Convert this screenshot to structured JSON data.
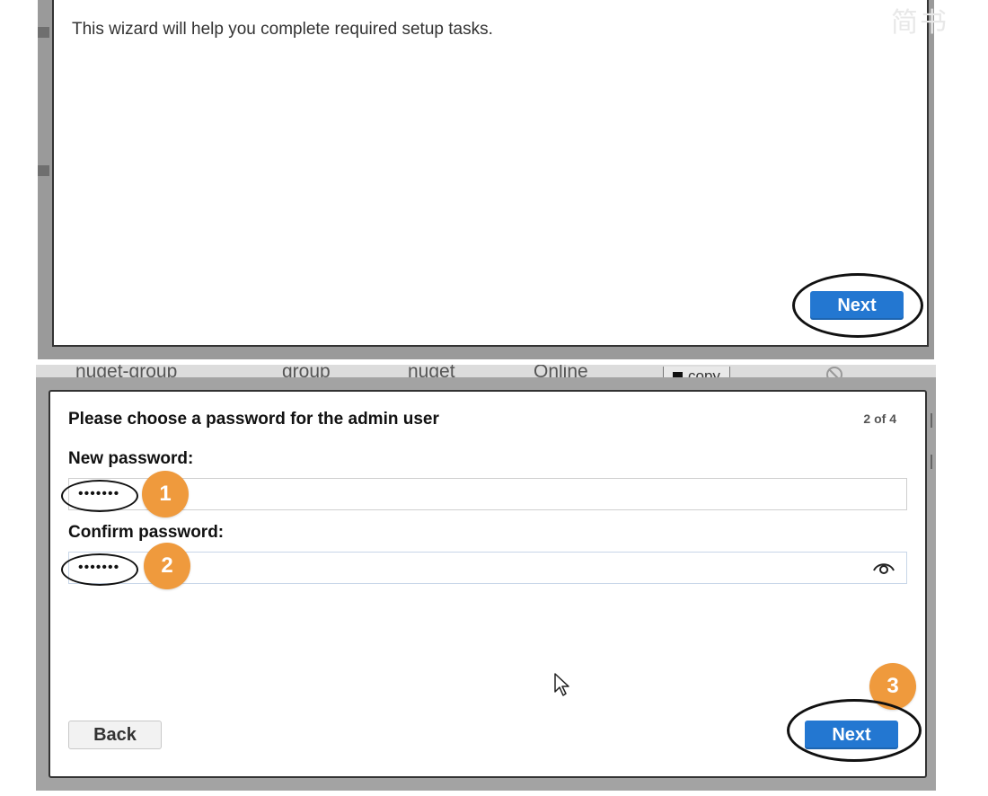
{
  "top_panel": {
    "intro_text": "This wizard will help you complete required setup tasks.",
    "next_label": "Next"
  },
  "background_row": {
    "cells": [
      "nuget-group",
      "group",
      "nuget",
      "Online"
    ],
    "copy_label": "copy"
  },
  "dialog": {
    "title": "Please choose a password for the admin user",
    "step": "2 of 4",
    "new_password_label": "New password:",
    "new_password_value": "•••••••",
    "confirm_password_label": "Confirm password:",
    "confirm_password_value": "•••••••",
    "back_label": "Back",
    "next_label": "Next"
  },
  "callouts": [
    "1",
    "2",
    "3"
  ],
  "watermark": "简书",
  "icons": {
    "eye": "show-password-eye-icon",
    "cursor": "mouse-pointer-icon",
    "ban": "disabled-circle-icon",
    "copy": "copy-square-icon"
  },
  "colors": {
    "primary_button": "#2377d1",
    "callout": "#ef9a3d",
    "annotation_outline": "#111111"
  }
}
